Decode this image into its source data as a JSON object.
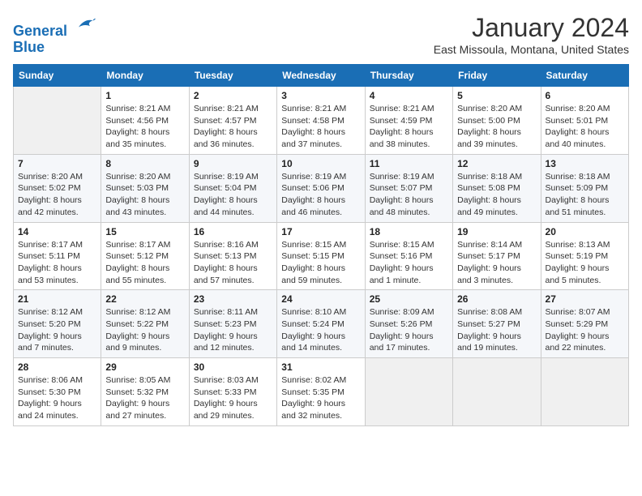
{
  "logo": {
    "line1": "General",
    "line2": "Blue"
  },
  "title": "January 2024",
  "subtitle": "East Missoula, Montana, United States",
  "weekdays": [
    "Sunday",
    "Monday",
    "Tuesday",
    "Wednesday",
    "Thursday",
    "Friday",
    "Saturday"
  ],
  "weeks": [
    [
      {
        "day": null,
        "info": ""
      },
      {
        "day": "1",
        "sunrise": "8:21 AM",
        "sunset": "4:56 PM",
        "daylight": "8 hours and 35 minutes."
      },
      {
        "day": "2",
        "sunrise": "8:21 AM",
        "sunset": "4:57 PM",
        "daylight": "8 hours and 36 minutes."
      },
      {
        "day": "3",
        "sunrise": "8:21 AM",
        "sunset": "4:58 PM",
        "daylight": "8 hours and 37 minutes."
      },
      {
        "day": "4",
        "sunrise": "8:21 AM",
        "sunset": "4:59 PM",
        "daylight": "8 hours and 38 minutes."
      },
      {
        "day": "5",
        "sunrise": "8:20 AM",
        "sunset": "5:00 PM",
        "daylight": "8 hours and 39 minutes."
      },
      {
        "day": "6",
        "sunrise": "8:20 AM",
        "sunset": "5:01 PM",
        "daylight": "8 hours and 40 minutes."
      }
    ],
    [
      {
        "day": "7",
        "sunrise": "8:20 AM",
        "sunset": "5:02 PM",
        "daylight": "8 hours and 42 minutes."
      },
      {
        "day": "8",
        "sunrise": "8:20 AM",
        "sunset": "5:03 PM",
        "daylight": "8 hours and 43 minutes."
      },
      {
        "day": "9",
        "sunrise": "8:19 AM",
        "sunset": "5:04 PM",
        "daylight": "8 hours and 44 minutes."
      },
      {
        "day": "10",
        "sunrise": "8:19 AM",
        "sunset": "5:06 PM",
        "daylight": "8 hours and 46 minutes."
      },
      {
        "day": "11",
        "sunrise": "8:19 AM",
        "sunset": "5:07 PM",
        "daylight": "8 hours and 48 minutes."
      },
      {
        "day": "12",
        "sunrise": "8:18 AM",
        "sunset": "5:08 PM",
        "daylight": "8 hours and 49 minutes."
      },
      {
        "day": "13",
        "sunrise": "8:18 AM",
        "sunset": "5:09 PM",
        "daylight": "8 hours and 51 minutes."
      }
    ],
    [
      {
        "day": "14",
        "sunrise": "8:17 AM",
        "sunset": "5:11 PM",
        "daylight": "8 hours and 53 minutes."
      },
      {
        "day": "15",
        "sunrise": "8:17 AM",
        "sunset": "5:12 PM",
        "daylight": "8 hours and 55 minutes."
      },
      {
        "day": "16",
        "sunrise": "8:16 AM",
        "sunset": "5:13 PM",
        "daylight": "8 hours and 57 minutes."
      },
      {
        "day": "17",
        "sunrise": "8:15 AM",
        "sunset": "5:15 PM",
        "daylight": "8 hours and 59 minutes."
      },
      {
        "day": "18",
        "sunrise": "8:15 AM",
        "sunset": "5:16 PM",
        "daylight": "9 hours and 1 minute."
      },
      {
        "day": "19",
        "sunrise": "8:14 AM",
        "sunset": "5:17 PM",
        "daylight": "9 hours and 3 minutes."
      },
      {
        "day": "20",
        "sunrise": "8:13 AM",
        "sunset": "5:19 PM",
        "daylight": "9 hours and 5 minutes."
      }
    ],
    [
      {
        "day": "21",
        "sunrise": "8:12 AM",
        "sunset": "5:20 PM",
        "daylight": "9 hours and 7 minutes."
      },
      {
        "day": "22",
        "sunrise": "8:12 AM",
        "sunset": "5:22 PM",
        "daylight": "9 hours and 9 minutes."
      },
      {
        "day": "23",
        "sunrise": "8:11 AM",
        "sunset": "5:23 PM",
        "daylight": "9 hours and 12 minutes."
      },
      {
        "day": "24",
        "sunrise": "8:10 AM",
        "sunset": "5:24 PM",
        "daylight": "9 hours and 14 minutes."
      },
      {
        "day": "25",
        "sunrise": "8:09 AM",
        "sunset": "5:26 PM",
        "daylight": "9 hours and 17 minutes."
      },
      {
        "day": "26",
        "sunrise": "8:08 AM",
        "sunset": "5:27 PM",
        "daylight": "9 hours and 19 minutes."
      },
      {
        "day": "27",
        "sunrise": "8:07 AM",
        "sunset": "5:29 PM",
        "daylight": "9 hours and 22 minutes."
      }
    ],
    [
      {
        "day": "28",
        "sunrise": "8:06 AM",
        "sunset": "5:30 PM",
        "daylight": "9 hours and 24 minutes."
      },
      {
        "day": "29",
        "sunrise": "8:05 AM",
        "sunset": "5:32 PM",
        "daylight": "9 hours and 27 minutes."
      },
      {
        "day": "30",
        "sunrise": "8:03 AM",
        "sunset": "5:33 PM",
        "daylight": "9 hours and 29 minutes."
      },
      {
        "day": "31",
        "sunrise": "8:02 AM",
        "sunset": "5:35 PM",
        "daylight": "9 hours and 32 minutes."
      },
      {
        "day": null,
        "info": ""
      },
      {
        "day": null,
        "info": ""
      },
      {
        "day": null,
        "info": ""
      }
    ]
  ]
}
